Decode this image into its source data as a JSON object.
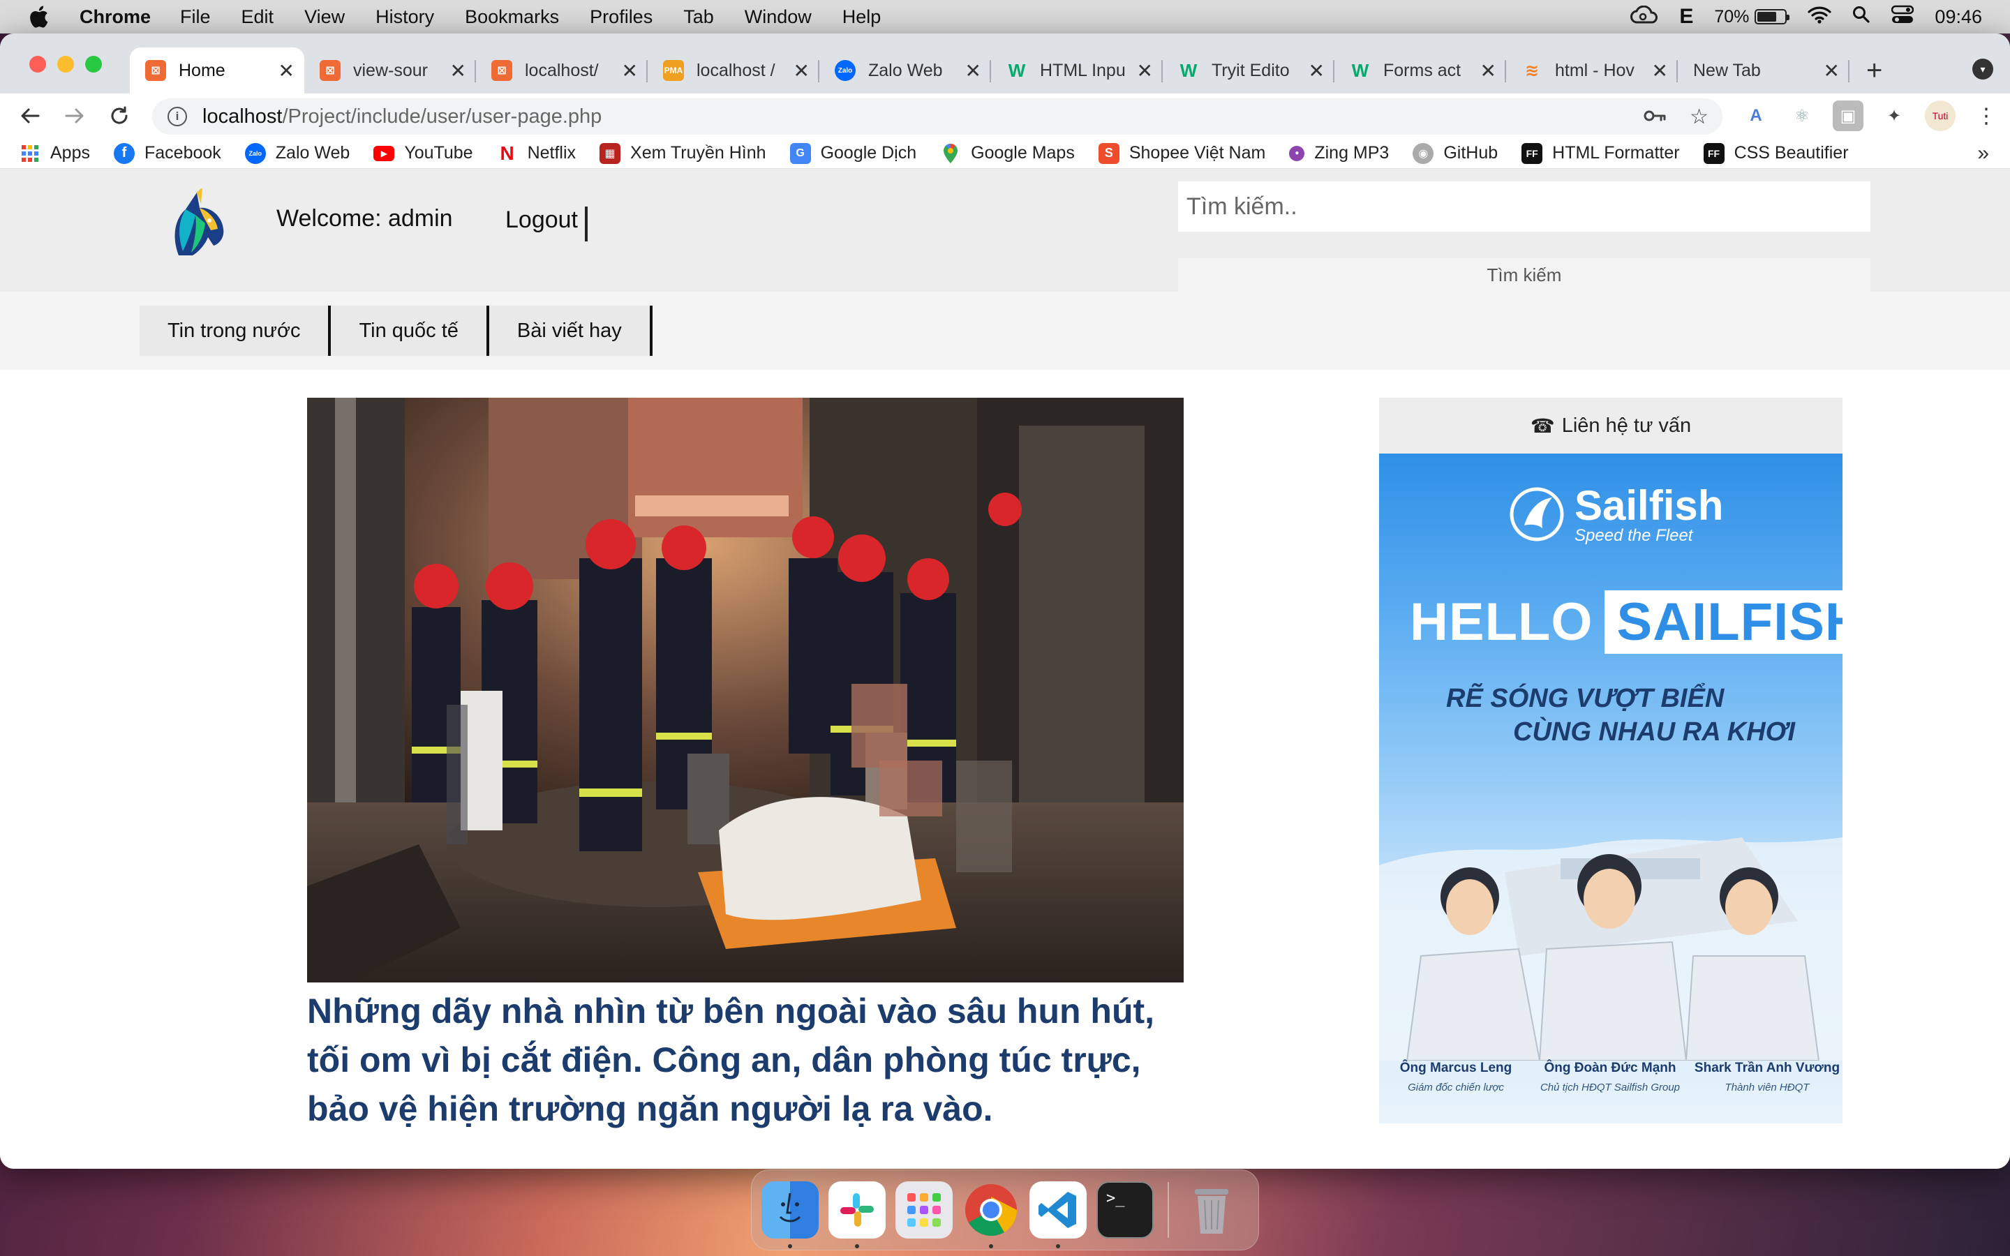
{
  "menubar": {
    "app": "Chrome",
    "items": [
      "File",
      "Edit",
      "View",
      "History",
      "Bookmarks",
      "Profiles",
      "Tab",
      "Window",
      "Help"
    ],
    "input_source": "E",
    "battery": "70%",
    "battery_level": 0.7,
    "time": "09:46"
  },
  "tabs": [
    {
      "title": "Home",
      "active": true,
      "icon": "xampp-icon",
      "color": "#f06a35"
    },
    {
      "title": "view-sour",
      "active": false,
      "icon": "xampp-icon",
      "color": "#f06a35"
    },
    {
      "title": "localhost/",
      "active": false,
      "icon": "xampp-icon",
      "color": "#f06a35"
    },
    {
      "title": "localhost /",
      "active": false,
      "icon": "phpmyadmin-icon",
      "color": "#f0a020"
    },
    {
      "title": "Zalo Web",
      "active": false,
      "icon": "zalo-icon",
      "color": "#0068ff"
    },
    {
      "title": "HTML Inpu",
      "active": false,
      "icon": "w3schools-icon",
      "color": "#04aa6d"
    },
    {
      "title": "Tryit Edito",
      "active": false,
      "icon": "w3schools-icon",
      "color": "#04aa6d"
    },
    {
      "title": "Forms act",
      "active": false,
      "icon": "w3schools-icon",
      "color": "#04aa6d"
    },
    {
      "title": "html - Hov",
      "active": false,
      "icon": "stackoverflow-icon",
      "color": "#f48024"
    },
    {
      "title": "New Tab",
      "active": false,
      "icon": "",
      "color": ""
    }
  ],
  "toolbar": {
    "url_host": "localhost",
    "url_path": "/Project/include/user/user-page.php"
  },
  "bookmarks": [
    {
      "label": "Apps",
      "icon": "apps-grid-icon",
      "color": "#4285f4"
    },
    {
      "label": "Facebook",
      "icon": "facebook-icon",
      "color": "#1877f2"
    },
    {
      "label": "Zalo Web",
      "icon": "zalo-icon",
      "color": "#0068ff"
    },
    {
      "label": "YouTube",
      "icon": "youtube-icon",
      "color": "#ff0000"
    },
    {
      "label": "Netflix",
      "icon": "netflix-icon",
      "color": "#e50914"
    },
    {
      "label": "Xem Truyền Hình",
      "icon": "tv-icon",
      "color": "#b8231f"
    },
    {
      "label": "Google Dịch",
      "icon": "google-translate-icon",
      "color": "#4285f4"
    },
    {
      "label": "Google Maps",
      "icon": "google-maps-icon",
      "color": "#34a853"
    },
    {
      "label": "Shopee Việt Nam",
      "icon": "shopee-icon",
      "color": "#ee4d2d"
    },
    {
      "label": "Zing MP3",
      "icon": "zing-mp3-icon",
      "color": "#8e44ad"
    },
    {
      "label": "GitHub",
      "icon": "github-icon",
      "color": "#6e6e6e"
    },
    {
      "label": "HTML Formatter",
      "icon": "ff-icon",
      "color": "#111111"
    },
    {
      "label": "CSS Beautifier",
      "icon": "ff-icon",
      "color": "#111111"
    }
  ],
  "site": {
    "welcome": "Welcome: admin",
    "logout": "Logout",
    "search_placeholder": "Tìm kiếm..",
    "search_button": "Tìm kiếm",
    "nav": [
      "Tin trong nước",
      "Tin quốc tế",
      "Bài viết hay"
    ],
    "article_title": "Những dãy nhà nhìn từ bên ngoài vào sâu hun hút, tối om vì bị cắt điện. Công an, dân phòng túc trực, bảo vệ hiện trường ngăn người lạ ra vào.",
    "sidebar_title": "Liên hệ tư vấn"
  },
  "ad": {
    "brand": "Sailfish",
    "tagline": "Speed the Fleet",
    "hello": "HELLO",
    "hello_box": "SAILFISH",
    "slogan_1": "RẼ SÓNG VƯỢT BIỂN",
    "slogan_2": "CÙNG NHAU RA KHƠI",
    "people": [
      {
        "name": "Ông Marcus Leng",
        "role": "Giám đốc chiến lược"
      },
      {
        "name": "Ông Đoàn Đức Mạnh",
        "role": "Chủ tịch HĐQT Sailfish Group"
      },
      {
        "name": "Shark Trần Anh Vương",
        "role": "Thành viên HĐQT"
      }
    ]
  },
  "dock": [
    "finder-icon",
    "slack-icon",
    "launchpad-icon",
    "chrome-icon",
    "vscode-icon",
    "terminal-icon",
    "trash-icon"
  ]
}
